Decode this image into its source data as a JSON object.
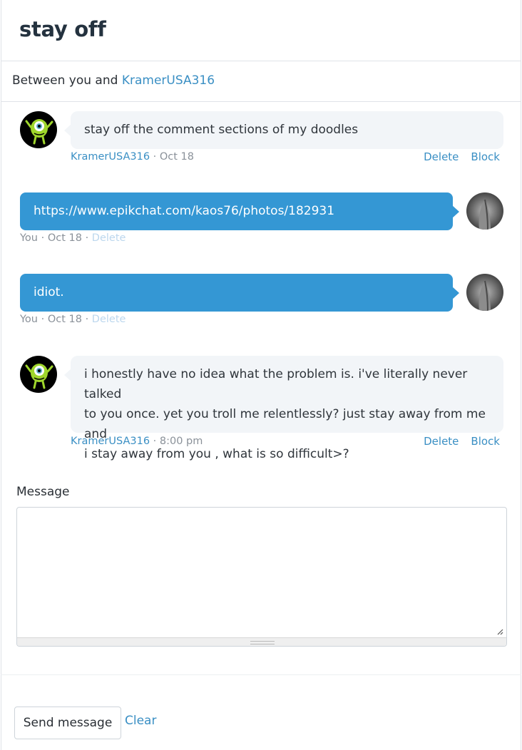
{
  "conversation": {
    "title": "stay off",
    "between_prefix": "Between you and",
    "partner_name": "KramerUSA316"
  },
  "messages": [
    {
      "direction": "incoming",
      "text": "stay off the comment sections of my doodles",
      "author": "KramerUSA316",
      "time": "Oct 18",
      "actions": [
        "Delete",
        "Block"
      ]
    },
    {
      "direction": "outgoing",
      "text": "https://www.epikchat.com/kaos76/photos/182931",
      "author": "You",
      "time": "Oct 18",
      "actions": [
        "Delete"
      ]
    },
    {
      "direction": "outgoing",
      "text": "idiot.",
      "author": "You",
      "time": "Oct 18",
      "actions": [
        "Delete"
      ]
    },
    {
      "direction": "incoming",
      "text_lines": [
        "i honestly have no idea what the problem is. i've literally never talked",
        "to you once. yet you troll me relentlessly? just stay away from me and",
        "i stay away from you , what is so difficult>?"
      ],
      "author": "KramerUSA316",
      "time": "8:00 pm",
      "actions": [
        "Delete",
        "Block"
      ]
    }
  ],
  "compose": {
    "label": "Message",
    "value": "",
    "send_label": "Send message",
    "clear_label": "Clear"
  },
  "icons": {
    "partner_avatar": "green-one-eyed-monster-avatar",
    "self_avatar": "grayscale-photo-avatar"
  },
  "colors": {
    "accent": "#3497d4",
    "link": "#3a8fc4",
    "incoming_bubble": "#f2f5f8"
  }
}
